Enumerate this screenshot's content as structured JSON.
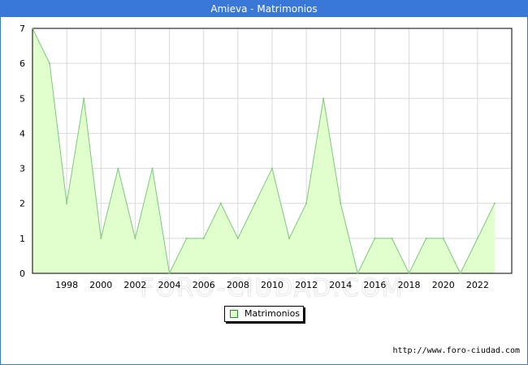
{
  "title": "Amieva - Matrimonios",
  "legend_label": "Matrimonios",
  "url_text": "http://www.foro-ciudad.com",
  "watermark": "FORO-CIUDAD.COM",
  "colors": {
    "title_bar": "#3a78d8",
    "line": "#7cc87c",
    "fill": "#e0ffcc",
    "grid": "#d9d9d9"
  },
  "chart_data": {
    "type": "area",
    "x": [
      1996,
      1997,
      1998,
      1999,
      2000,
      2001,
      2002,
      2003,
      2004,
      2005,
      2006,
      2007,
      2008,
      2009,
      2010,
      2011,
      2012,
      2013,
      2014,
      2015,
      2016,
      2017,
      2018,
      2019,
      2020,
      2021,
      2022,
      2023
    ],
    "series": [
      {
        "name": "Matrimonios",
        "values": [
          7,
          6,
          2,
          5,
          1,
          3,
          1,
          3,
          0,
          1,
          1,
          2,
          1,
          2,
          3,
          1,
          2,
          5,
          2,
          0,
          1,
          1,
          0,
          1,
          1,
          0,
          1,
          2
        ]
      }
    ],
    "xticks": [
      "1998",
      "2000",
      "2002",
      "2004",
      "2006",
      "2008",
      "2010",
      "2012",
      "2014",
      "2016",
      "2018",
      "2020",
      "2022"
    ],
    "yticks": [
      "0",
      "1",
      "2",
      "3",
      "4",
      "5",
      "6",
      "7"
    ],
    "xlim": [
      1996,
      2024
    ],
    "ylim": [
      0,
      7
    ],
    "grid": true,
    "legend_position": "bottom"
  }
}
